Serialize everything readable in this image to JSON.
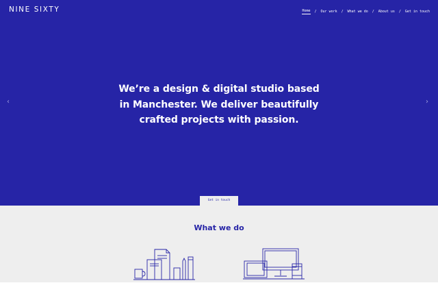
{
  "brand": {
    "logo_text": "NINE SIXTY"
  },
  "nav": {
    "items": [
      {
        "label": "Home",
        "active": true
      },
      {
        "label": "Our work",
        "active": false
      },
      {
        "label": "What we do",
        "active": false
      },
      {
        "label": "About us",
        "active": false
      },
      {
        "label": "Get in touch",
        "active": false
      }
    ],
    "separator": "/"
  },
  "hero": {
    "background": "#2624a6",
    "headline_lines": [
      "We’re a design & digital studio based",
      "in Manchester. We deliver beautifully",
      "crafted projects with passion."
    ],
    "prev_arrow": "‹",
    "next_arrow": "›",
    "cta_label": "Get in touch"
  },
  "what_we_do": {
    "title": "What we do",
    "background": "#eeeeee",
    "icons": [
      "print-stationery-icon",
      "devices-icon"
    ]
  },
  "colors": {
    "accent": "#2624a6",
    "light": "#eeeeee",
    "text_on_accent": "#ffffff"
  }
}
